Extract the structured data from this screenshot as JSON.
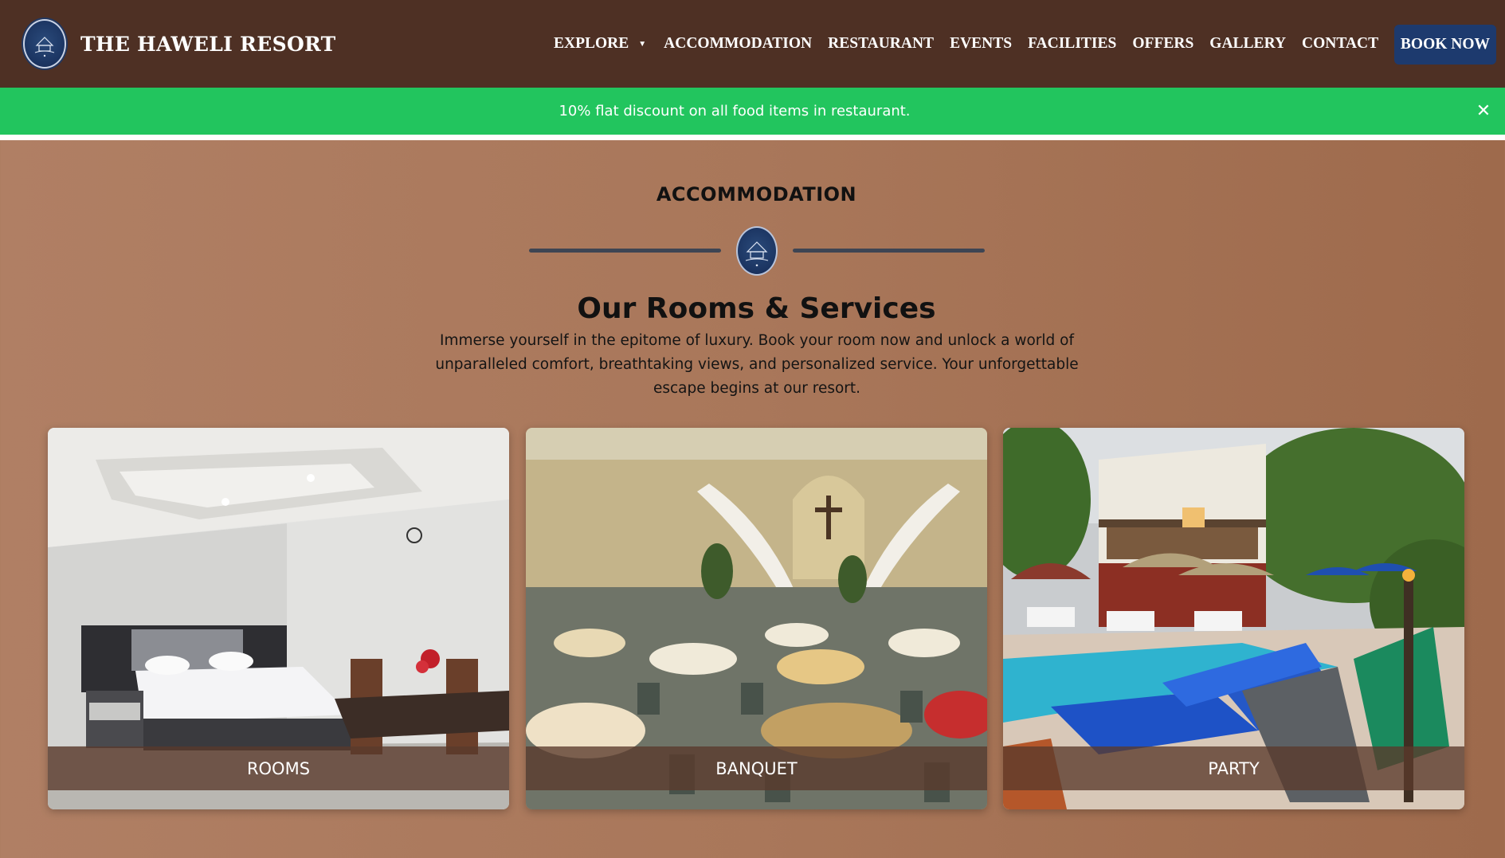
{
  "brand": {
    "name": "THE HAWELI RESORT",
    "logo_alt": "The Haweli Resort"
  },
  "nav": {
    "items": [
      {
        "label": "EXPLORE",
        "has_dropdown": true
      },
      {
        "label": "ACCOMMODATION"
      },
      {
        "label": "RESTAURANT"
      },
      {
        "label": "EVENTS"
      },
      {
        "label": "FACILITIES"
      },
      {
        "label": "OFFERS"
      },
      {
        "label": "GALLERY"
      },
      {
        "label": "CONTACT"
      }
    ],
    "book_now": "BOOK NOW"
  },
  "banner": {
    "text": "10% flat discount on all food items in restaurant.",
    "close_icon": "close-icon",
    "color": "#22c55e"
  },
  "section": {
    "label": "ACCOMMODATION",
    "heading": "Our Rooms & Services",
    "description": "Immerse yourself in the epitome of luxury. Book your room now and unlock a world of unparalleled comfort, breathtaking views, and personalized service. Your unforgettable escape begins at our resort."
  },
  "cards": [
    {
      "caption": "ROOMS",
      "image": "bedroom-photo"
    },
    {
      "caption": "BANQUET",
      "image": "banquet-hall-photo"
    },
    {
      "caption": "PARTY",
      "image": "poolside-party-photo"
    }
  ],
  "colors": {
    "navbar": "#4e3024",
    "book_button": "#1d3a6e",
    "background": "#a9775a"
  }
}
